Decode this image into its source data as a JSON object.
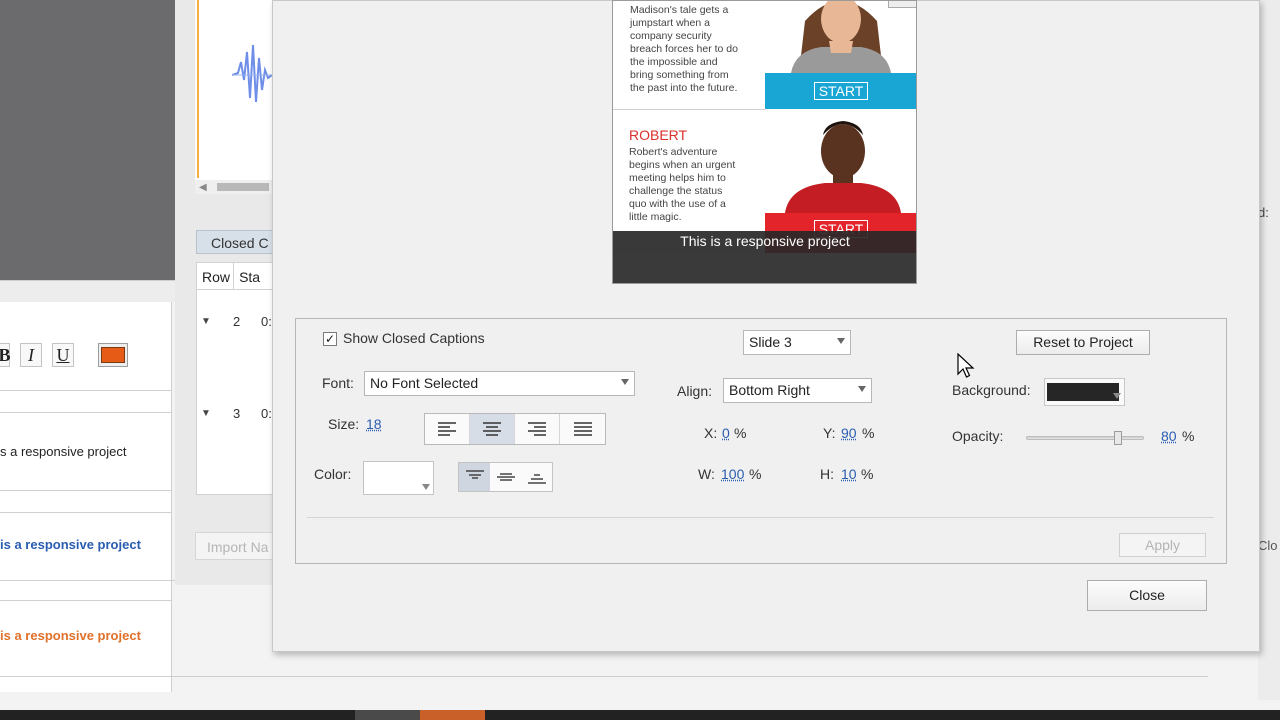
{
  "background_app": {
    "closed_captions_tab": "Closed C",
    "grid_headers": [
      "Row",
      "Sta"
    ],
    "rows": [
      {
        "num": "2",
        "time": "0:"
      },
      {
        "num": "3",
        "time": "0:"
      }
    ],
    "caption_plain": "s a responsive project",
    "caption_blue": "is a responsive project",
    "caption_orange": "is a responsive project",
    "import_button": "Import Na",
    "format_buttons": [
      "B",
      "I",
      "U"
    ],
    "text_color": "#e65c16",
    "right_edge_label": "Clo",
    "right_edge_d": "d:"
  },
  "preview": {
    "character1": {
      "desc_lines": [
        "Madison's tale gets a",
        "jumpstart when a",
        "company security",
        "breach forces her to do",
        "the impossible and",
        "bring something from",
        "the past into the future."
      ],
      "start": "START",
      "start_color": "#1aa6d4"
    },
    "character2": {
      "name": "ROBERT",
      "desc_lines": [
        "Robert's adventure",
        "begins when an urgent",
        "meeting helps him to",
        "challenge the status",
        "quo with the use of a",
        "little magic."
      ],
      "start": "START",
      "start_color": "#e3242b"
    },
    "caption_text": "This is a responsive project"
  },
  "settings": {
    "show_cc_label": "Show Closed Captions",
    "show_cc_checked": true,
    "slide_select": "Slide 3",
    "reset_button": "Reset to Project",
    "font_label": "Font:",
    "font_value": "No Font Selected",
    "align_label": "Align:",
    "align_value": "Bottom Right",
    "background_label": "Background:",
    "background_color": "#262626",
    "size_label": "Size:",
    "size_value": "18",
    "x_label": "X:",
    "x_value": "0",
    "y_label": "Y:",
    "y_value": "90",
    "w_label": "W:",
    "w_value": "100",
    "h_label": "H:",
    "h_value": "10",
    "percent": "%",
    "opacity_label": "Opacity:",
    "opacity_value": "80",
    "opacity_fraction": 0.8,
    "color_label": "Color:",
    "apply_button": "Apply",
    "close_button": "Close",
    "text_align_selected": "center",
    "vertical_align_selected": "top"
  }
}
